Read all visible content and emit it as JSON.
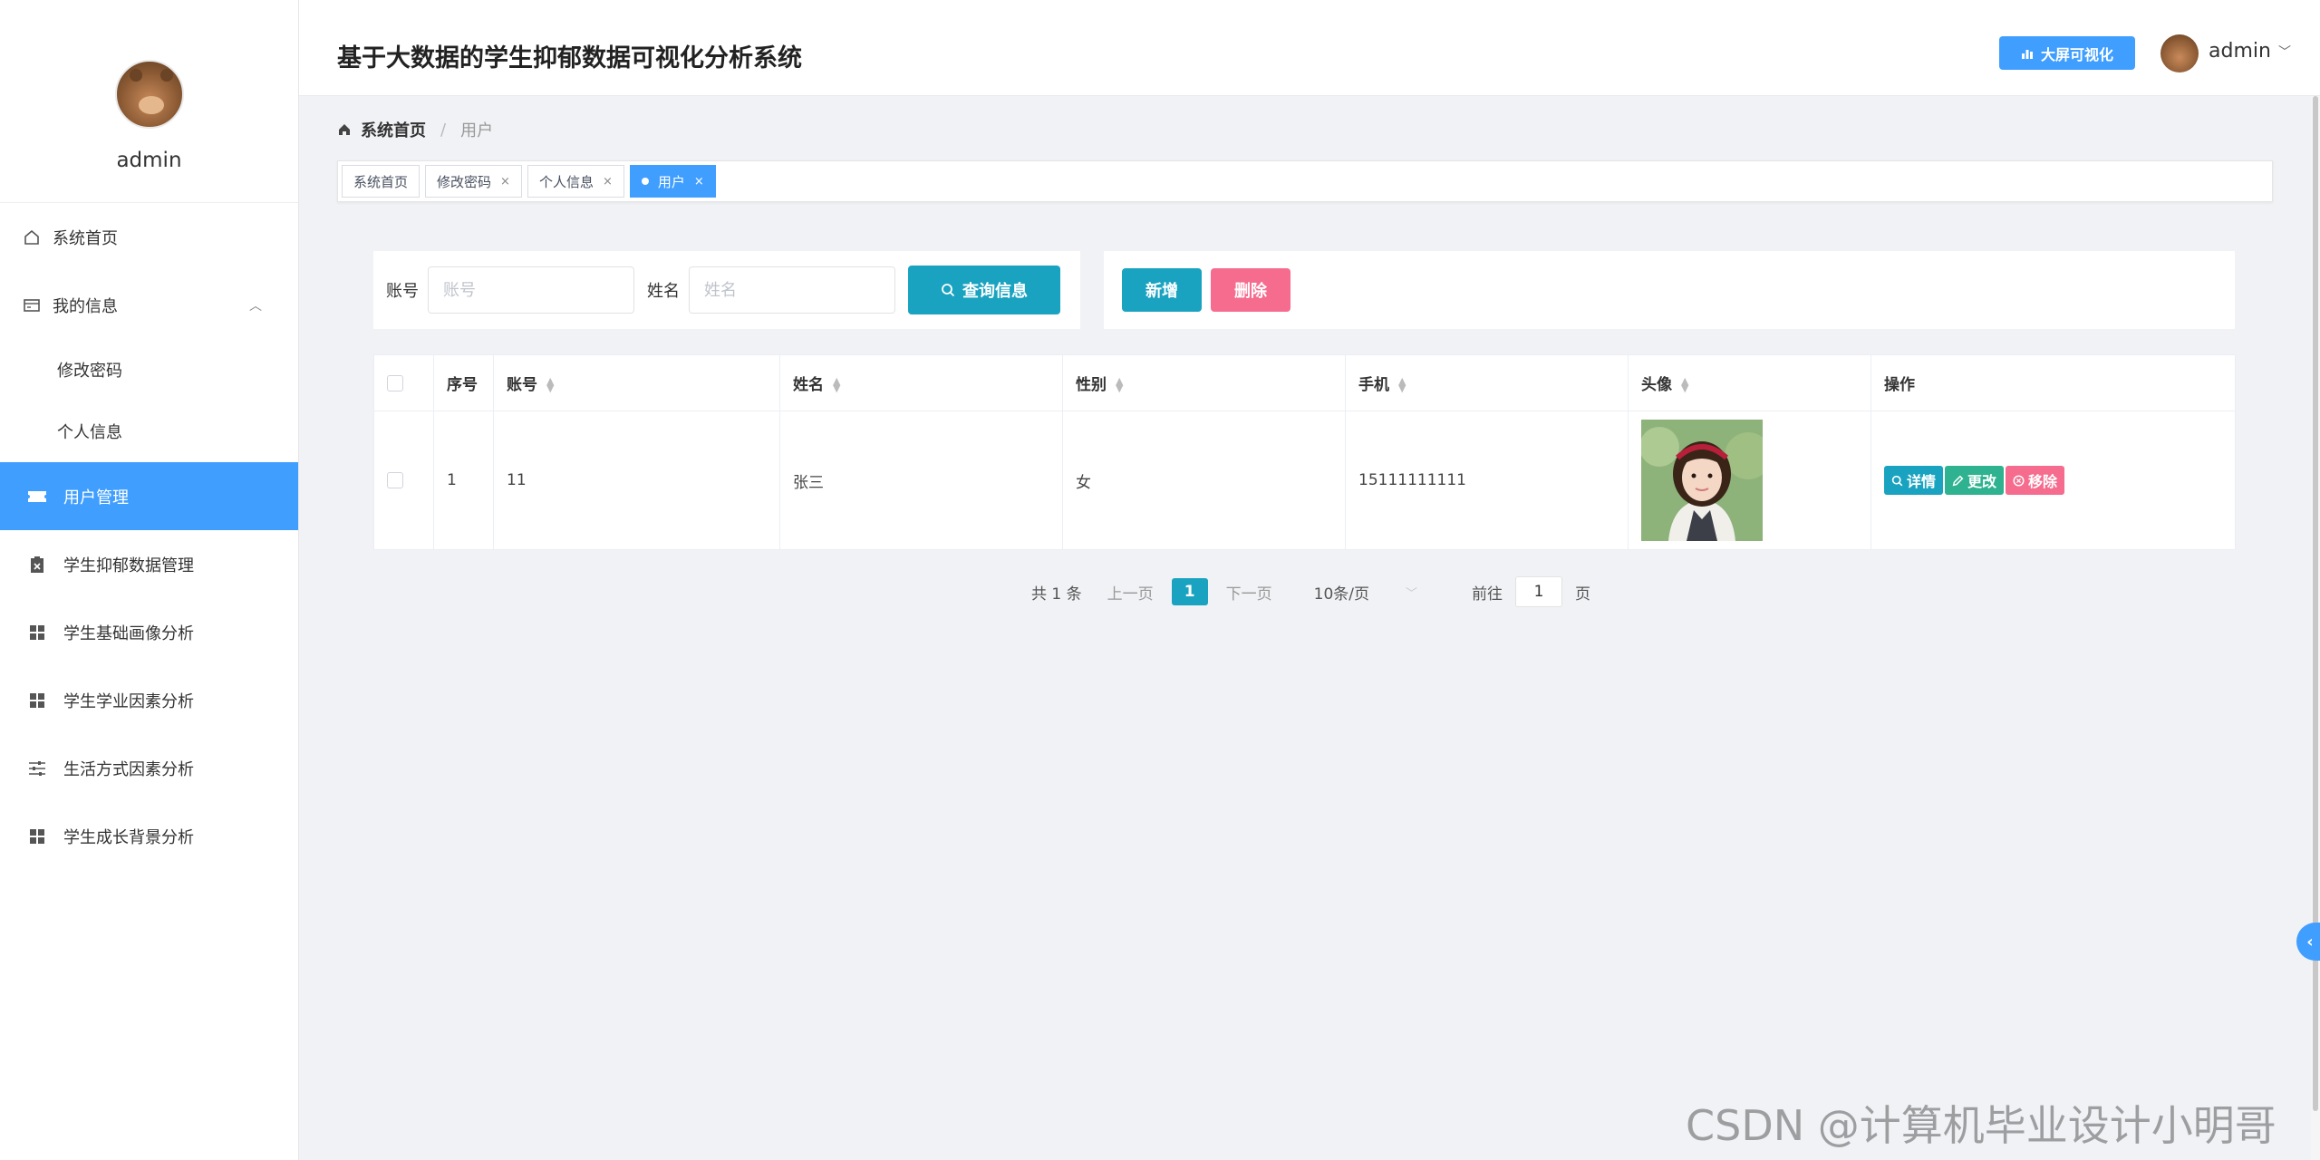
{
  "sidebar": {
    "username": "admin",
    "items": [
      {
        "label": "系统首页",
        "icon": "home-icon"
      },
      {
        "label": "我的信息",
        "icon": "profile-card-icon",
        "expanded": true,
        "children": [
          {
            "label": "修改密码"
          },
          {
            "label": "个人信息"
          }
        ]
      },
      {
        "label": "用户管理",
        "icon": "ticket-icon",
        "active": true
      },
      {
        "label": "学生抑郁数据管理",
        "icon": "clipboard-icon"
      },
      {
        "label": "学生基础画像分析",
        "icon": "grid-icon"
      },
      {
        "label": "学生学业因素分析",
        "icon": "grid-icon"
      },
      {
        "label": "生活方式因素分析",
        "icon": "sliders-icon"
      },
      {
        "label": "学生成长背景分析",
        "icon": "grid-icon"
      }
    ]
  },
  "header": {
    "title": "基于大数据的学生抑郁数据可视化分析系统",
    "bigscreen_label": "大屏可视化",
    "user": "admin"
  },
  "breadcrumb": {
    "home": "系统首页",
    "current": "用户"
  },
  "tags": [
    {
      "label": "系统首页",
      "closable": false,
      "active": false
    },
    {
      "label": "修改密码",
      "closable": true,
      "active": false
    },
    {
      "label": "个人信息",
      "closable": true,
      "active": false
    },
    {
      "label": "用户",
      "closable": true,
      "active": true
    }
  ],
  "search": {
    "account_label": "账号",
    "account_placeholder": "账号",
    "name_label": "姓名",
    "name_placeholder": "姓名",
    "search_button": "查询信息"
  },
  "actions": {
    "add": "新增",
    "delete": "删除"
  },
  "table": {
    "columns": [
      "序号",
      "账号",
      "姓名",
      "性别",
      "手机",
      "头像",
      "操作"
    ],
    "rows": [
      {
        "index": "1",
        "account": "11",
        "name": "张三",
        "gender": "女",
        "phone": "15111111111",
        "ops": [
          "详情",
          "更改",
          "移除"
        ]
      }
    ]
  },
  "pagination": {
    "total": "共 1 条",
    "prev": "上一页",
    "current": "1",
    "next": "下一页",
    "page_size": "10条/页",
    "goto_label": "前往",
    "goto_value": "1",
    "page_suffix": "页"
  },
  "watermark": "CSDN @计算机毕业设计小明哥",
  "colors": {
    "primary": "#409eff",
    "teal": "#1aa3c0",
    "pink": "#f56c8e",
    "green": "#2fb28f"
  }
}
